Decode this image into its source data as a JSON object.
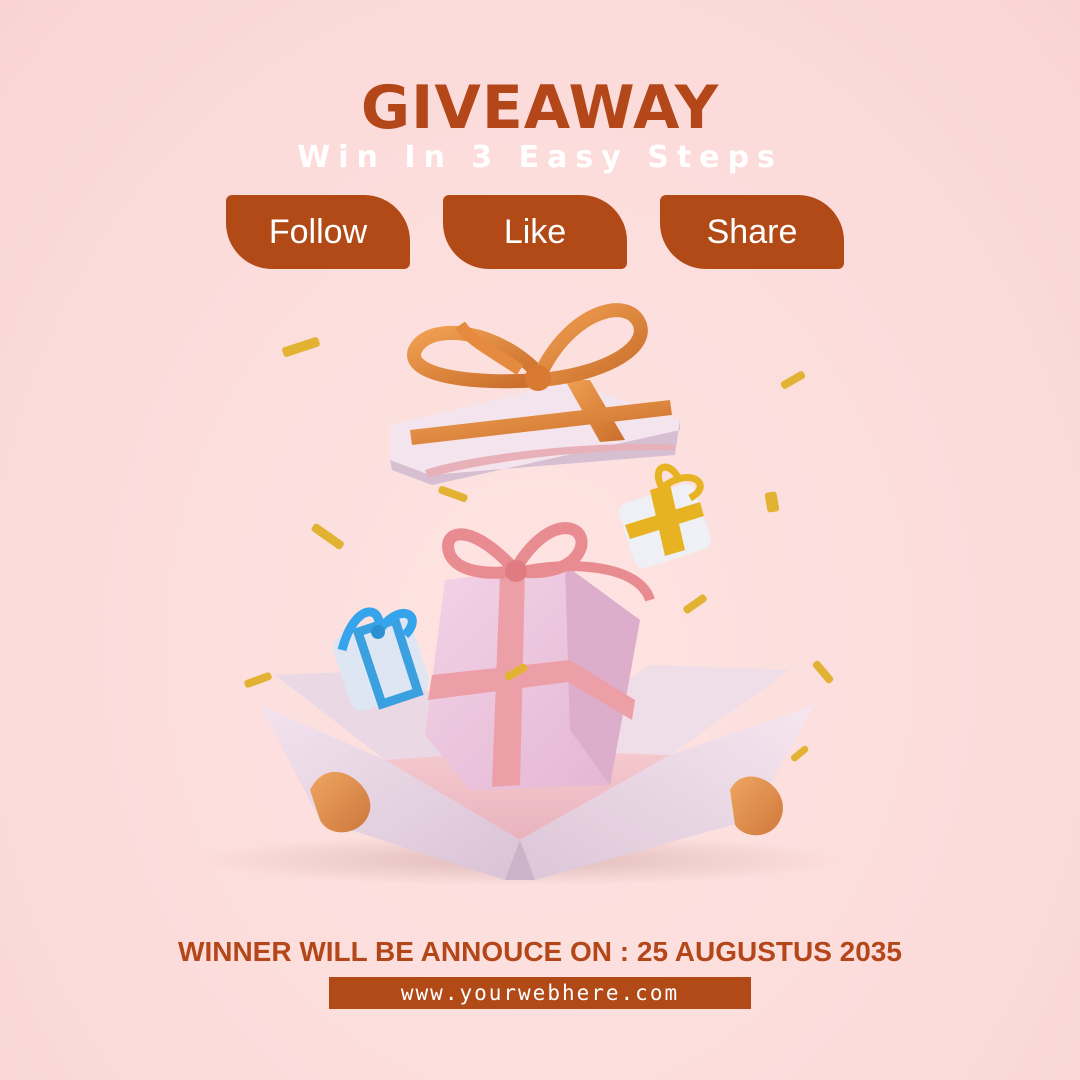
{
  "header": {
    "title": "GIVEAWAY",
    "subtitle": "Win In 3 Easy Steps"
  },
  "steps": [
    {
      "label": "Follow"
    },
    {
      "label": "Like"
    },
    {
      "label": "Share"
    }
  ],
  "footer": {
    "announcement": "WINNER WILL BE ANNOUCE ON : 25 AUGUSTUS 2035",
    "website": "www.yourwebhere.com"
  },
  "colors": {
    "background": "#fde0de",
    "accent": "#b14a17",
    "title_text": "#b4471a",
    "subtitle_text": "#ffffff"
  },
  "illustration": {
    "icons": [
      "gift-box-open-icon",
      "gift-lid-orange-ribbon-icon",
      "gift-pink-icon",
      "gift-blue-ribbon-icon",
      "gift-yellow-ribbon-icon",
      "confetti-icon"
    ]
  }
}
